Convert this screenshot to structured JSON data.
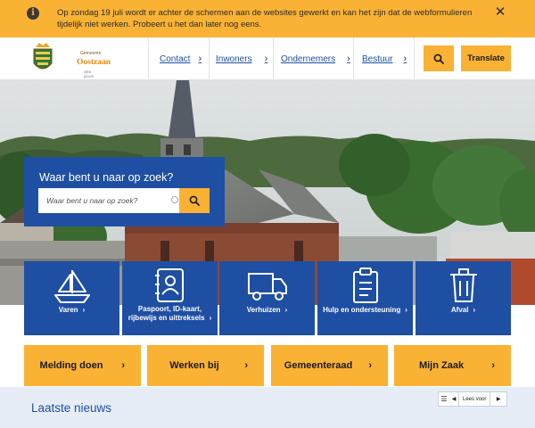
{
  "notice": {
    "text": "Op zondag 19 juli wordt er achter de schermen aan de websites gewerkt en kan het zijn dat de webformulieren tijdelijk niet werken. Probeert u het dan later nog eens.",
    "info_icon": "info-icon",
    "close_icon": "close-icon"
  },
  "logo": {
    "top": "Gemeente",
    "name": "Oostzaan",
    "sub": "rijke groen"
  },
  "nav": {
    "items": [
      {
        "label": "Contact"
      },
      {
        "label": "Inwoners"
      },
      {
        "label": "Ondernemers"
      },
      {
        "label": "Bestuur"
      }
    ],
    "chevron": "›",
    "translate_label": "Translate",
    "search_icon": "search-icon"
  },
  "search": {
    "title": "Waar bent u naar op zoek?",
    "placeholder": "Waar bent u naar op zoek?"
  },
  "tiles": [
    {
      "label": "Varen",
      "icon": "sailboat-icon"
    },
    {
      "label": "Paspoort, ID-kaart, rijbewijs en uittreksels",
      "icon": "id-card-icon"
    },
    {
      "label": "Verhuizen",
      "icon": "truck-icon"
    },
    {
      "label": "Hulp en ondersteuning",
      "icon": "clipboard-icon"
    },
    {
      "label": "Afval",
      "icon": "trash-icon"
    }
  ],
  "quick_links": [
    {
      "label": "Melding doen"
    },
    {
      "label": "Werken bij"
    },
    {
      "label": "Gemeenteraad"
    },
    {
      "label": "Mijn Zaak"
    }
  ],
  "news": {
    "title": "Laatste nieuws",
    "reader_label": "Lees voor"
  },
  "colors": {
    "accent_yellow": "#f9b233",
    "brand_blue": "#1f4fa3",
    "news_bg": "#e6edf6"
  }
}
